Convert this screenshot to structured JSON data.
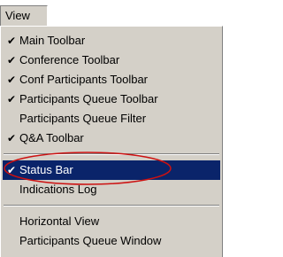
{
  "menubar": {
    "title": "View"
  },
  "menu": {
    "items": [
      {
        "label": "Main Toolbar",
        "checked": true
      },
      {
        "label": "Conference Toolbar",
        "checked": true
      },
      {
        "label": "Conf Participants Toolbar",
        "checked": true
      },
      {
        "label": "Participants Queue Toolbar",
        "checked": true
      },
      {
        "label": "Participants Queue Filter",
        "checked": false
      },
      {
        "label": "Q&A Toolbar",
        "checked": true
      },
      {
        "label": "Status Bar",
        "checked": true,
        "selected": true
      },
      {
        "label": "Indications Log",
        "checked": false
      },
      {
        "label": "Horizontal View",
        "checked": false
      },
      {
        "label": "Participants Queue Window",
        "checked": false
      }
    ],
    "check_glyph": "✔"
  },
  "colors": {
    "menu_bg": "#d4d0c8",
    "highlight_bg": "#0a246a",
    "highlight_text": "#ffffff",
    "annotation_ellipse": "#cc1111"
  }
}
